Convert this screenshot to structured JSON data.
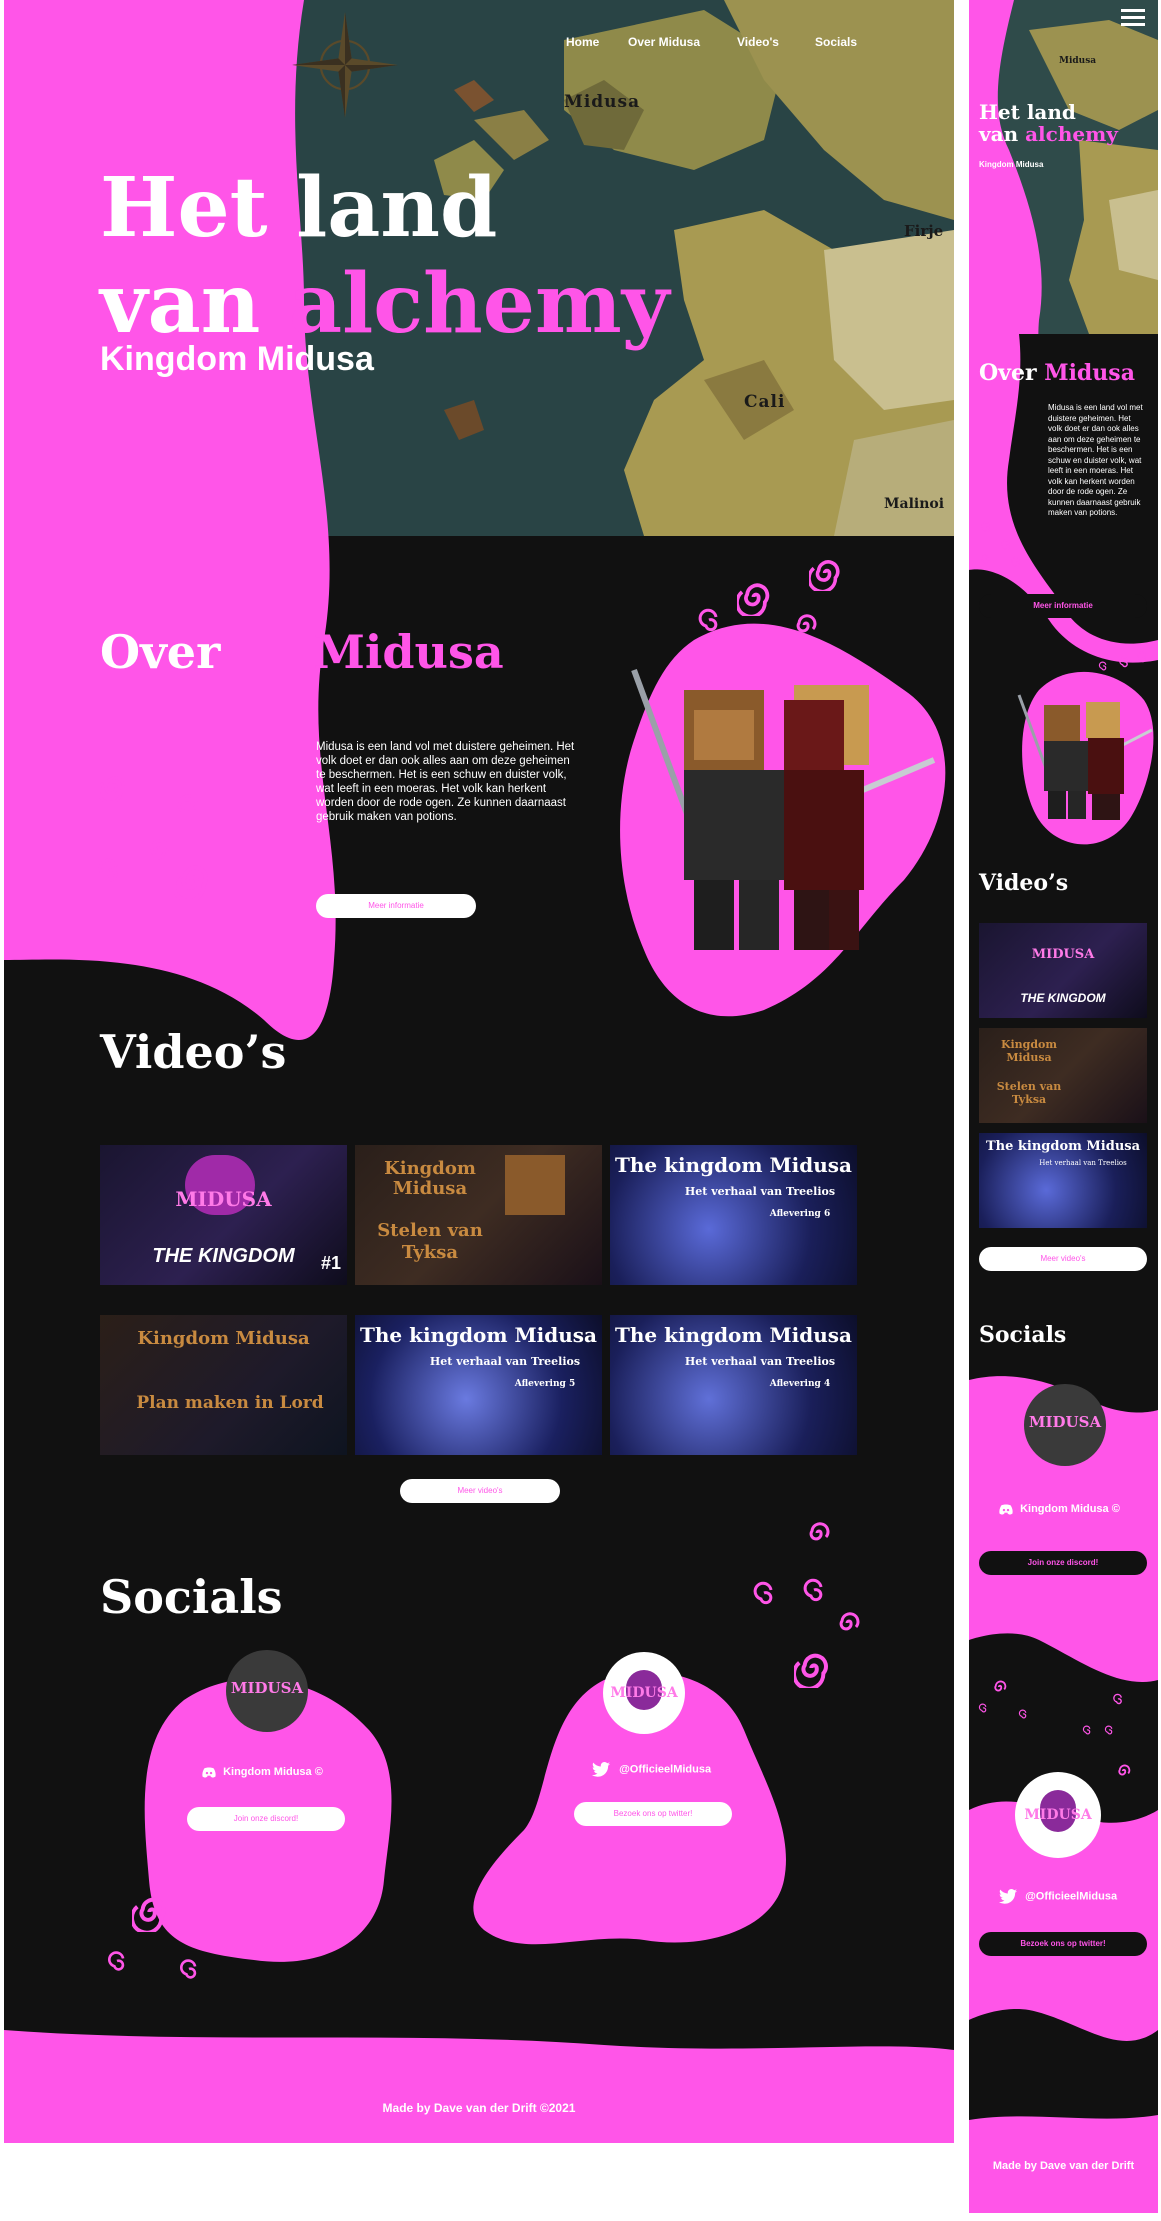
{
  "nav": {
    "items": [
      "Home",
      "Over Midusa",
      "Video's",
      "Socials"
    ]
  },
  "hero": {
    "title_line1": "Het land",
    "title_line2_white": "van",
    "title_line2_pink": "alchemy",
    "subtitle": "Kingdom Midusa"
  },
  "map_labels": [
    "Midusa",
    "Cali",
    "Firje",
    "Malinoi"
  ],
  "about": {
    "heading_white": "Over",
    "heading_pink": "Midusa",
    "body": "Midusa is een land vol met duistere geheimen. Het volk doet er dan ook alles aan om deze geheimen te beschermen. Het is een schuw en duister volk, wat leeft in een moeras. Het volk kan herkent worden door de rode ogen. Ze kunnen daarnaast gebruik maken van potions.",
    "button": "Meer informatie"
  },
  "videos": {
    "heading": "Video’s",
    "button": "Meer video's",
    "thumbs": [
      {
        "line1": "MIDUSA",
        "line2": "THE KINGDOM",
        "badge": "#1",
        "variant": "midusa"
      },
      {
        "line1": "Kingdom Midusa",
        "line2": "Stelen van Tyksa",
        "badge": "",
        "variant": "stelen"
      },
      {
        "line1": "The kingdom Midusa",
        "line2": "Het verhaal van Treelios",
        "badge": "Aflevering 6",
        "variant": "blue"
      },
      {
        "line1": "Kingdom Midusa",
        "line2": "Plan maken in Lord",
        "badge": "",
        "variant": "plan"
      },
      {
        "line1": "The kingdom Midusa",
        "line2": "Het verhaal van Treelios",
        "badge": "Aflevering 5",
        "variant": "blue"
      },
      {
        "line1": "The kingdom Midusa",
        "line2": "Het verhaal van Treelios",
        "badge": "Aflevering 4",
        "variant": "blue"
      }
    ]
  },
  "socials": {
    "heading": "Socials",
    "discord": {
      "label": "Kingdom Midusa ©",
      "button": "Join onze discord!",
      "logo": "MIDUSA"
    },
    "twitter": {
      "label": "@OfficieelMidusa",
      "button": "Bezoek ons op twitter!",
      "logo": "MIDUSA"
    }
  },
  "footer": {
    "text": "Made by Dave van der Drift ©2021"
  },
  "mobile": {
    "map_label": "Midusa",
    "hero_line1": "Het land",
    "hero_line2_white": "van",
    "hero_line2_pink": "alchemy",
    "hero_sub": "Kingdom Midusa",
    "about_white": "Over",
    "about_pink": "Midusa",
    "about_body": "Midusa is een land vol met duistere geheimen. Het volk doet er dan ook alles aan om deze geheimen te beschermen. Het is een schuw en duister volk, wat leeft in een moeras. Het volk kan herkent worden door de rode ogen. Ze kunnen daarnaast gebruik maken van potions.",
    "about_button": "Meer informatie",
    "videos_heading": "Video’s",
    "videos_button": "Meer video's",
    "socials_heading": "Socials",
    "discord_label": "Kingdom Midusa ©",
    "discord_button": "Join onze discord!",
    "twitter_label": "@OfficieelMidusa",
    "twitter_button": "Bezoek ons op twitter!",
    "footer": "Made by Dave van der Drift"
  },
  "colors": {
    "accent": "#ff55e8",
    "background": "#111111",
    "text": "#ffffff",
    "map_sea": "#2f4b4a",
    "map_land": "#a89a52"
  },
  "icons": [
    "compass-icon",
    "hamburger-menu-icon",
    "discord-icon",
    "twitter-icon",
    "spiral-icon"
  ]
}
